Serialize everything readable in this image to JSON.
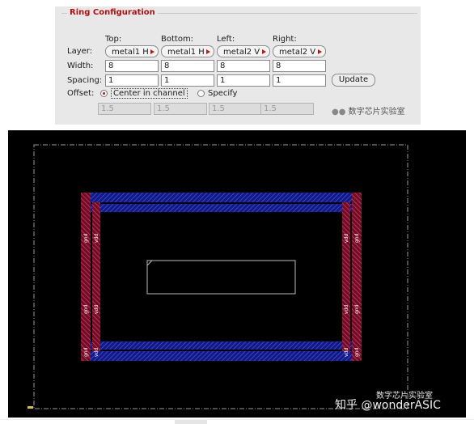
{
  "dialog": {
    "title": "Ring Configuration",
    "columns": [
      "Top:",
      "Bottom:",
      "Left:",
      "Right:"
    ],
    "row_labels": {
      "layer": "Layer:",
      "width": "Width:",
      "spacing": "Spacing:",
      "offset": "Offset:"
    },
    "layers": [
      "metal1 H",
      "metal1 H",
      "metal2 V",
      "metal2 V"
    ],
    "widths": [
      "8",
      "8",
      "8",
      "8"
    ],
    "spacings": [
      "1",
      "1",
      "1",
      "1"
    ],
    "offsets": [
      "1.5",
      "1.5",
      "1.5",
      "1.5"
    ],
    "update_label": "Update",
    "offset_options": {
      "center": "Center in channel",
      "specify": "Specify",
      "selected": "center"
    }
  },
  "watermarks": {
    "top": "数字芯片实验室",
    "bottom": "知乎 @wonderASIC",
    "bottom_sub": "数字芯片实验室"
  },
  "layout_view": {
    "pin_labels": [
      "gnd",
      "vdd",
      "gnd",
      "vdd",
      "gnd",
      "vdd",
      "vdd",
      "gnd",
      "vdd",
      "gnd",
      "vdd",
      "gnd"
    ],
    "colors": {
      "metal1": "#1f2fd6",
      "metal2": "#d42a5a",
      "core_outline": "#bcbcbc",
      "die_outline": "#9a9a9a"
    }
  }
}
